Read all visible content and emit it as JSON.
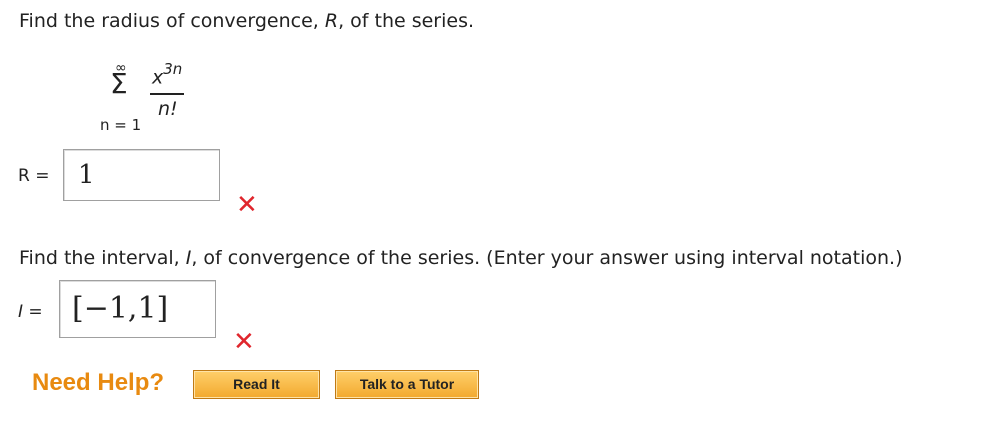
{
  "question1": {
    "prompt_pre": "Find the radius of convergence, ",
    "prompt_var": "R",
    "prompt_post": ", of the series.",
    "series": {
      "upper_limit": "∞",
      "sigma": "Σ",
      "lower_limit": "n = 1",
      "numerator_base": "x",
      "numerator_exponent": "3n",
      "denominator": "n!"
    },
    "answer_label": "R =",
    "answer_value": "1",
    "status_icon": "x-mark-icon"
  },
  "question2": {
    "prompt_pre": "Find the interval, ",
    "prompt_var": "I",
    "prompt_post": ", of convergence of the series. (Enter your answer using interval notation.)",
    "answer_label": "I =",
    "answer_value": "[−1,1]",
    "status_icon": "x-mark-icon"
  },
  "help": {
    "label": "Need Help?",
    "buttons": [
      "Read It",
      "Talk to a Tutor"
    ]
  },
  "colors": {
    "incorrect_mark": "#e0262d",
    "help_text": "#e88a10",
    "button_fill": "#f2a92e"
  }
}
